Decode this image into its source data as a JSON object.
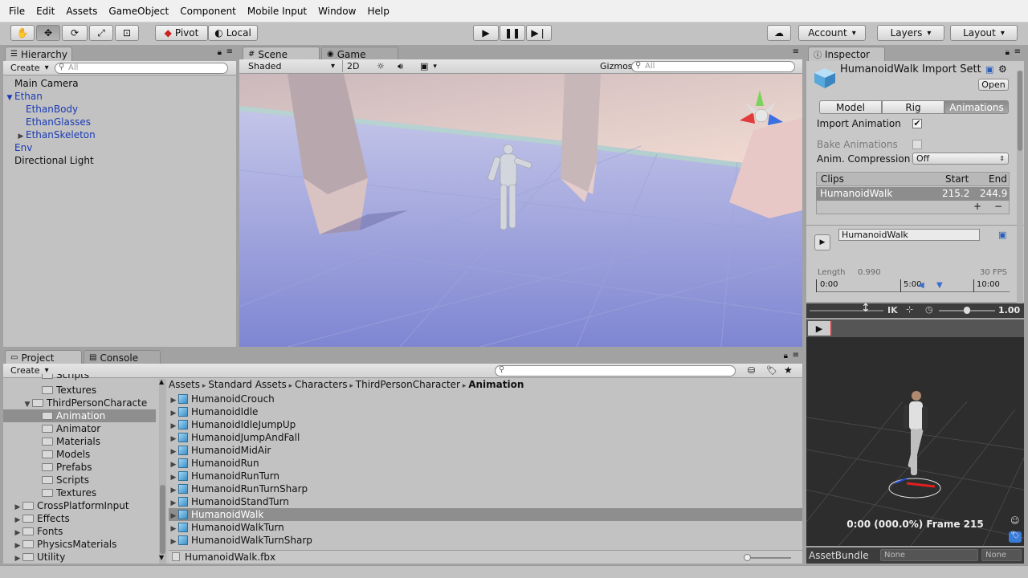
{
  "menu": [
    "File",
    "Edit",
    "Assets",
    "GameObject",
    "Component",
    "Mobile Input",
    "Window",
    "Help"
  ],
  "toolbar": {
    "pivot": "Pivot",
    "local": "Local",
    "account": "Account",
    "layers": "Layers",
    "layout": "Layout"
  },
  "hierarchy": {
    "tab": "Hierarchy",
    "create": "Create",
    "search_placeholder": "All",
    "items": [
      {
        "label": "Main Camera",
        "indent": 0,
        "color": "#111111",
        "arrow": ""
      },
      {
        "label": "Ethan",
        "indent": 0,
        "color": "#1a3bb5",
        "arrow": "▼"
      },
      {
        "label": "EthanBody",
        "indent": 1,
        "color": "#1a3bb5",
        "arrow": ""
      },
      {
        "label": "EthanGlasses",
        "indent": 1,
        "color": "#1a3bb5",
        "arrow": ""
      },
      {
        "label": "EthanSkeleton",
        "indent": 1,
        "color": "#1a3bb5",
        "arrow": "▶"
      },
      {
        "label": "Env",
        "indent": 0,
        "color": "#1a3bb5",
        "arrow": ""
      },
      {
        "label": "Directional Light",
        "indent": 0,
        "color": "#111111",
        "arrow": ""
      }
    ]
  },
  "scene": {
    "tab_scene": "Scene",
    "tab_game": "Game",
    "shading": "Shaded",
    "mode_2d": "2D",
    "gizmos": "Gizmos",
    "search_placeholder": "All"
  },
  "inspector": {
    "tab": "Inspector",
    "title": "HumanoidWalk Import Sett",
    "open": "Open",
    "tabs": [
      "Model",
      "Rig",
      "Animations"
    ],
    "import_animation_label": "Import Animation",
    "import_animation_checked": true,
    "bake_animations_label": "Bake Animations",
    "bake_animations_checked": false,
    "anim_compression_label": "Anim. Compression",
    "anim_compression_value": "Off",
    "clips_header": "Clips",
    "start_header": "Start",
    "end_header": "End",
    "clip_name": "HumanoidWalk",
    "clip_start": "215.2",
    "clip_end": "244.9",
    "add_symbol": "+",
    "remove_symbol": "−",
    "clip_name_field": "HumanoidWalk",
    "length_label": "Length",
    "length_value": "0.990",
    "fps": "30 FPS",
    "timeline": [
      "0:00",
      "5:00",
      "10:00"
    ],
    "ik_label": "IK",
    "speed": "1.00"
  },
  "preview": {
    "status": "0:00 (000.0%) Frame 215"
  },
  "assetbundle": {
    "label": "AssetBundle",
    "value1": "None",
    "value2": "None"
  },
  "project": {
    "tab_project": "Project",
    "tab_console": "Console",
    "create": "Create",
    "tree": [
      {
        "label": "Scripts",
        "indent": 4,
        "arrow": "",
        "partial": true
      },
      {
        "label": "Textures",
        "indent": 4,
        "arrow": ""
      },
      {
        "label": "ThirdPersonCharacte",
        "indent": 3,
        "arrow": "▼"
      },
      {
        "label": "Animation",
        "indent": 4,
        "arrow": "",
        "selected": true
      },
      {
        "label": "Animator",
        "indent": 4,
        "arrow": ""
      },
      {
        "label": "Materials",
        "indent": 4,
        "arrow": ""
      },
      {
        "label": "Models",
        "indent": 4,
        "arrow": ""
      },
      {
        "label": "Prefabs",
        "indent": 4,
        "arrow": ""
      },
      {
        "label": "Scripts",
        "indent": 4,
        "arrow": ""
      },
      {
        "label": "Textures",
        "indent": 4,
        "arrow": ""
      },
      {
        "label": "CrossPlatformInput",
        "indent": 2,
        "arrow": "▶"
      },
      {
        "label": "Effects",
        "indent": 2,
        "arrow": "▶"
      },
      {
        "label": "Fonts",
        "indent": 2,
        "arrow": "▶"
      },
      {
        "label": "PhysicsMaterials",
        "indent": 2,
        "arrow": "▶"
      },
      {
        "label": "Utility",
        "indent": 2,
        "arrow": "▶"
      }
    ],
    "breadcrumb": [
      "Assets",
      "Standard Assets",
      "Characters",
      "ThirdPersonCharacter",
      "Animation"
    ],
    "files": [
      {
        "label": "HumanoidCrouch"
      },
      {
        "label": "HumanoidIdle"
      },
      {
        "label": "HumanoidIdleJumpUp"
      },
      {
        "label": "HumanoidJumpAndFall"
      },
      {
        "label": "HumanoidMidAir"
      },
      {
        "label": "HumanoidRun"
      },
      {
        "label": "HumanoidRunTurn"
      },
      {
        "label": "HumanoidRunTurnSharp"
      },
      {
        "label": "HumanoidStandTurn"
      },
      {
        "label": "HumanoidWalk",
        "selected": true
      },
      {
        "label": "HumanoidWalkTurn"
      },
      {
        "label": "HumanoidWalkTurnSharp"
      }
    ],
    "footer_file": "HumanoidWalk.fbx"
  }
}
